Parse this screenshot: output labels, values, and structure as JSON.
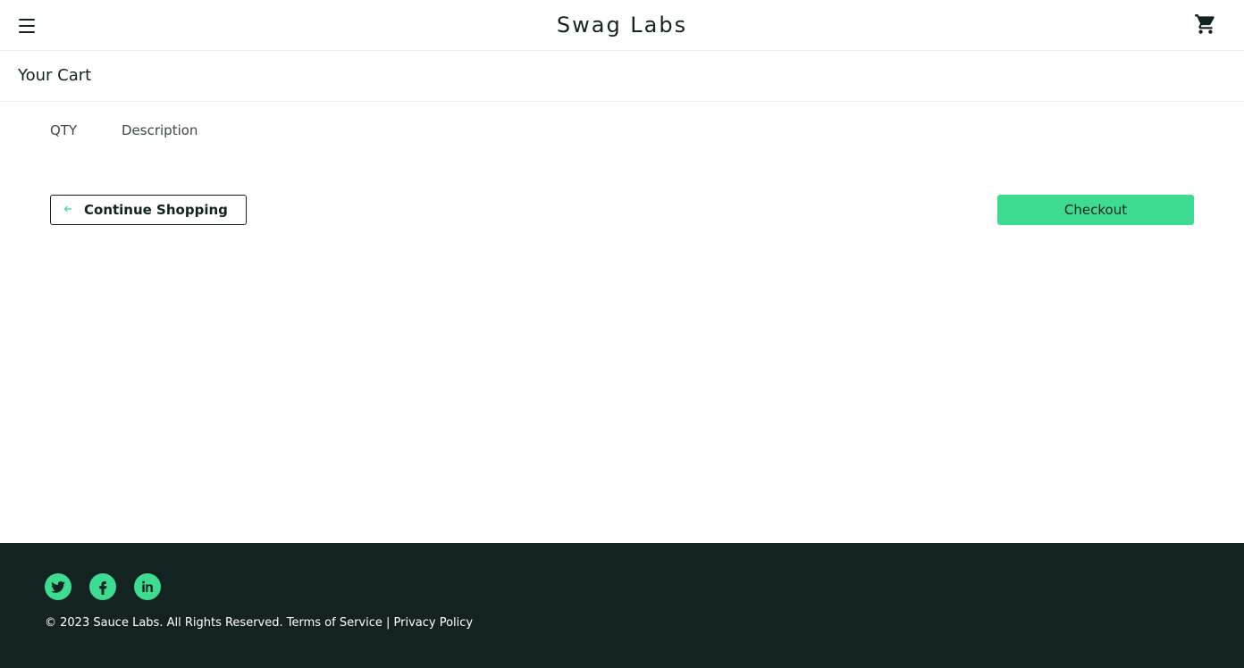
{
  "header": {
    "logo": "Swag Labs",
    "menu_icon": "hamburger-menu-icon",
    "cart_icon": "shopping-cart-icon"
  },
  "page": {
    "title": "Your Cart"
  },
  "cart": {
    "qty_label": "QTY",
    "description_label": "Description"
  },
  "actions": {
    "continue_label": "Continue Shopping",
    "checkout_label": "Checkout"
  },
  "footer": {
    "social": [
      "twitter-icon",
      "facebook-icon",
      "linkedin-icon"
    ],
    "copyright": "© 2023 Sauce Labs. All Rights Reserved. Terms of Service | Privacy Policy"
  },
  "colors": {
    "accent": "#3ddc91",
    "dark": "#132322"
  }
}
